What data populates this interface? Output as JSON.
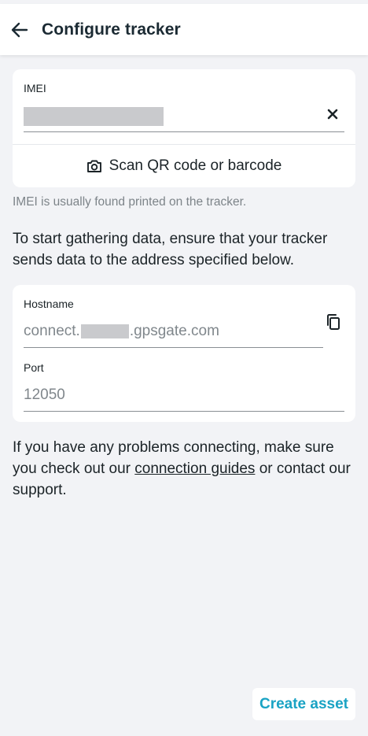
{
  "app_bar": {
    "title": "Configure tracker",
    "back_icon": "arrow-left-icon"
  },
  "imei": {
    "label": "IMEI",
    "value_redacted": true,
    "clear_icon": "close-icon",
    "scan_label": "Scan QR code or barcode",
    "scan_icon": "camera-icon",
    "hint": "IMEI is usually found printed on the tracker."
  },
  "intro_text": "To start gathering data, ensure that your tracker sends data to the address specified below.",
  "connection": {
    "hostname_label": "Hostname",
    "hostname_prefix": "connect.",
    "hostname_suffix": ".gpsgate.com",
    "copy_icon": "copy-icon",
    "port_label": "Port",
    "port_value": "12050"
  },
  "help": {
    "before": "If you have any problems connecting, make sure you check out our ",
    "link": "connection guides",
    "after": " or contact our support."
  },
  "actions": {
    "create_label": "Create asset"
  },
  "colors": {
    "accent": "#1aa3c4",
    "background": "#f2f3f6",
    "text": "#1b2327",
    "muted": "#7d8489"
  }
}
